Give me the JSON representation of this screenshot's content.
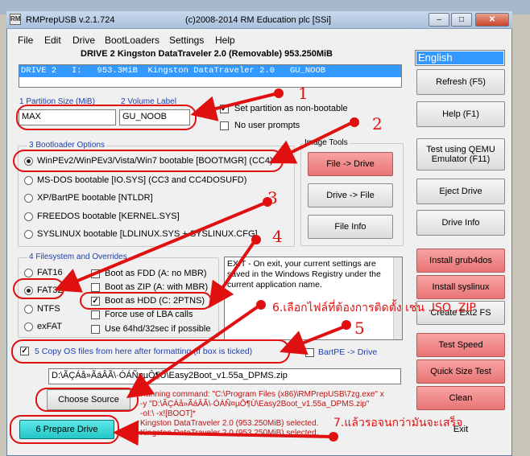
{
  "window": {
    "title": "RMPrepUSB v.2.1.724",
    "copyright": "(c)2008-2014 RM Education plc [SSi]",
    "icon": "rm-icon",
    "controls": {
      "minimize": "–",
      "maximize": "□",
      "close": "✕"
    }
  },
  "menu": [
    "File",
    "Edit",
    "Drive",
    "BootLoaders",
    "Settings",
    "Help"
  ],
  "drive": {
    "header": "DRIVE 2 Kingston DataTraveler 2.0  (Removable) 953.250MiB",
    "row": "DRIVE 2   I:   953.3MiB  Kingston DataTraveler 2.0   GU_NOOB"
  },
  "language": "English",
  "partition": {
    "size_label": "1 Partition Size (MiB)",
    "size_value": "MAX",
    "volume_label": "2 Volume Label",
    "volume_value": "GU_NOOB",
    "non_bootable": "Set partition as non-bootable",
    "no_prompts": "No user prompts"
  },
  "bootloader": {
    "title": "3 Bootloader Options",
    "options": [
      "WinPEv2/WinPEv3/Vista/Win7 bootable [BOOTMGR] (CC4)",
      "MS-DOS bootable [IO.SYS]    (CC3 and CC4DOSUFD)",
      "XP/BartPE bootable [NTLDR]",
      "FREEDOS bootable [KERNEL.SYS]",
      "SYSLINUX bootable [LDLINUX.SYS + SYSLINUX.CFG]"
    ],
    "selected": 0
  },
  "image_tools": {
    "title": "Image Tools",
    "file_to_drive": "File -> Drive",
    "drive_to_file": "Drive -> File",
    "file_info": "File Info"
  },
  "filesystem": {
    "title": "4 Filesystem and Overrides",
    "options": [
      "FAT16",
      "FAT32",
      "NTFS",
      "exFAT"
    ],
    "selected": 1,
    "overrides": [
      {
        "label": "Boot as FDD (A: no MBR)",
        "checked": false
      },
      {
        "label": "Boot as ZIP (A: with MBR)",
        "checked": false
      },
      {
        "label": "Boot as HDD (C: 2PTNS)",
        "checked": true
      },
      {
        "label": "Force use of LBA calls",
        "checked": false
      },
      {
        "label": "Use 64hd/32sec if possible",
        "checked": false
      }
    ]
  },
  "info_text": "EXIT - On exit, your current settings are saved in the Windows Registry under the current application name.",
  "copy_os": {
    "label": "5 Copy OS files from here after formatting (if box is ticked)",
    "checked": true,
    "bartpe": "BartPE -> Drive",
    "path": "D:\\ÃÇÁå»ÃáÂÃ\\·ÓÁÑ¤µÔ¶Ù\\Easy2Boot_v1.55a_DPMS.zip"
  },
  "buttons": {
    "refresh": "Refresh (F5)",
    "help": "Help (F1)",
    "qemu": "Test using QEMU Emulator (F11)",
    "eject": "Eject Drive",
    "drive_info": "Drive Info",
    "grub4dos": "Install grub4dos",
    "syslinux": "Install syslinux",
    "ext2": "Create Ext2 FS",
    "test_speed": "Test Speed",
    "quick_size": "Quick Size Test",
    "clean": "Clean",
    "exit": "Exit",
    "choose_source": "Choose Source",
    "prepare": "6 Prepare Drive"
  },
  "log": [
    "Running command: \"C:\\Program Files (x86)\\RMPrepUSB\\7zg.exe\" x",
    "-y \"D:\\ÃÇÁå»ÃáÂÃ\\·ÓÁÑ¤µÔ¶Ù\\Easy2Boot_v1.55a_DPMS.zip\"",
    "-oI:\\ -x![BOOT]*",
    "Kingston DataTraveler 2.0 (953.250MiB) selected.",
    "Kingston DataTraveler 2.0 (953.250MiB) selected."
  ],
  "annotations": {
    "n1": "1",
    "n2": "2",
    "n3": "3",
    "n4": "4",
    "n5": "5",
    "step6": "6.เลือกไฟล์ที่ต้องการติดตั้ง เช่น .ISO ,ZIP",
    "step7": "7.แล้วรอจนกว่ามันจะเสร็จ",
    "color": "#e01010"
  }
}
